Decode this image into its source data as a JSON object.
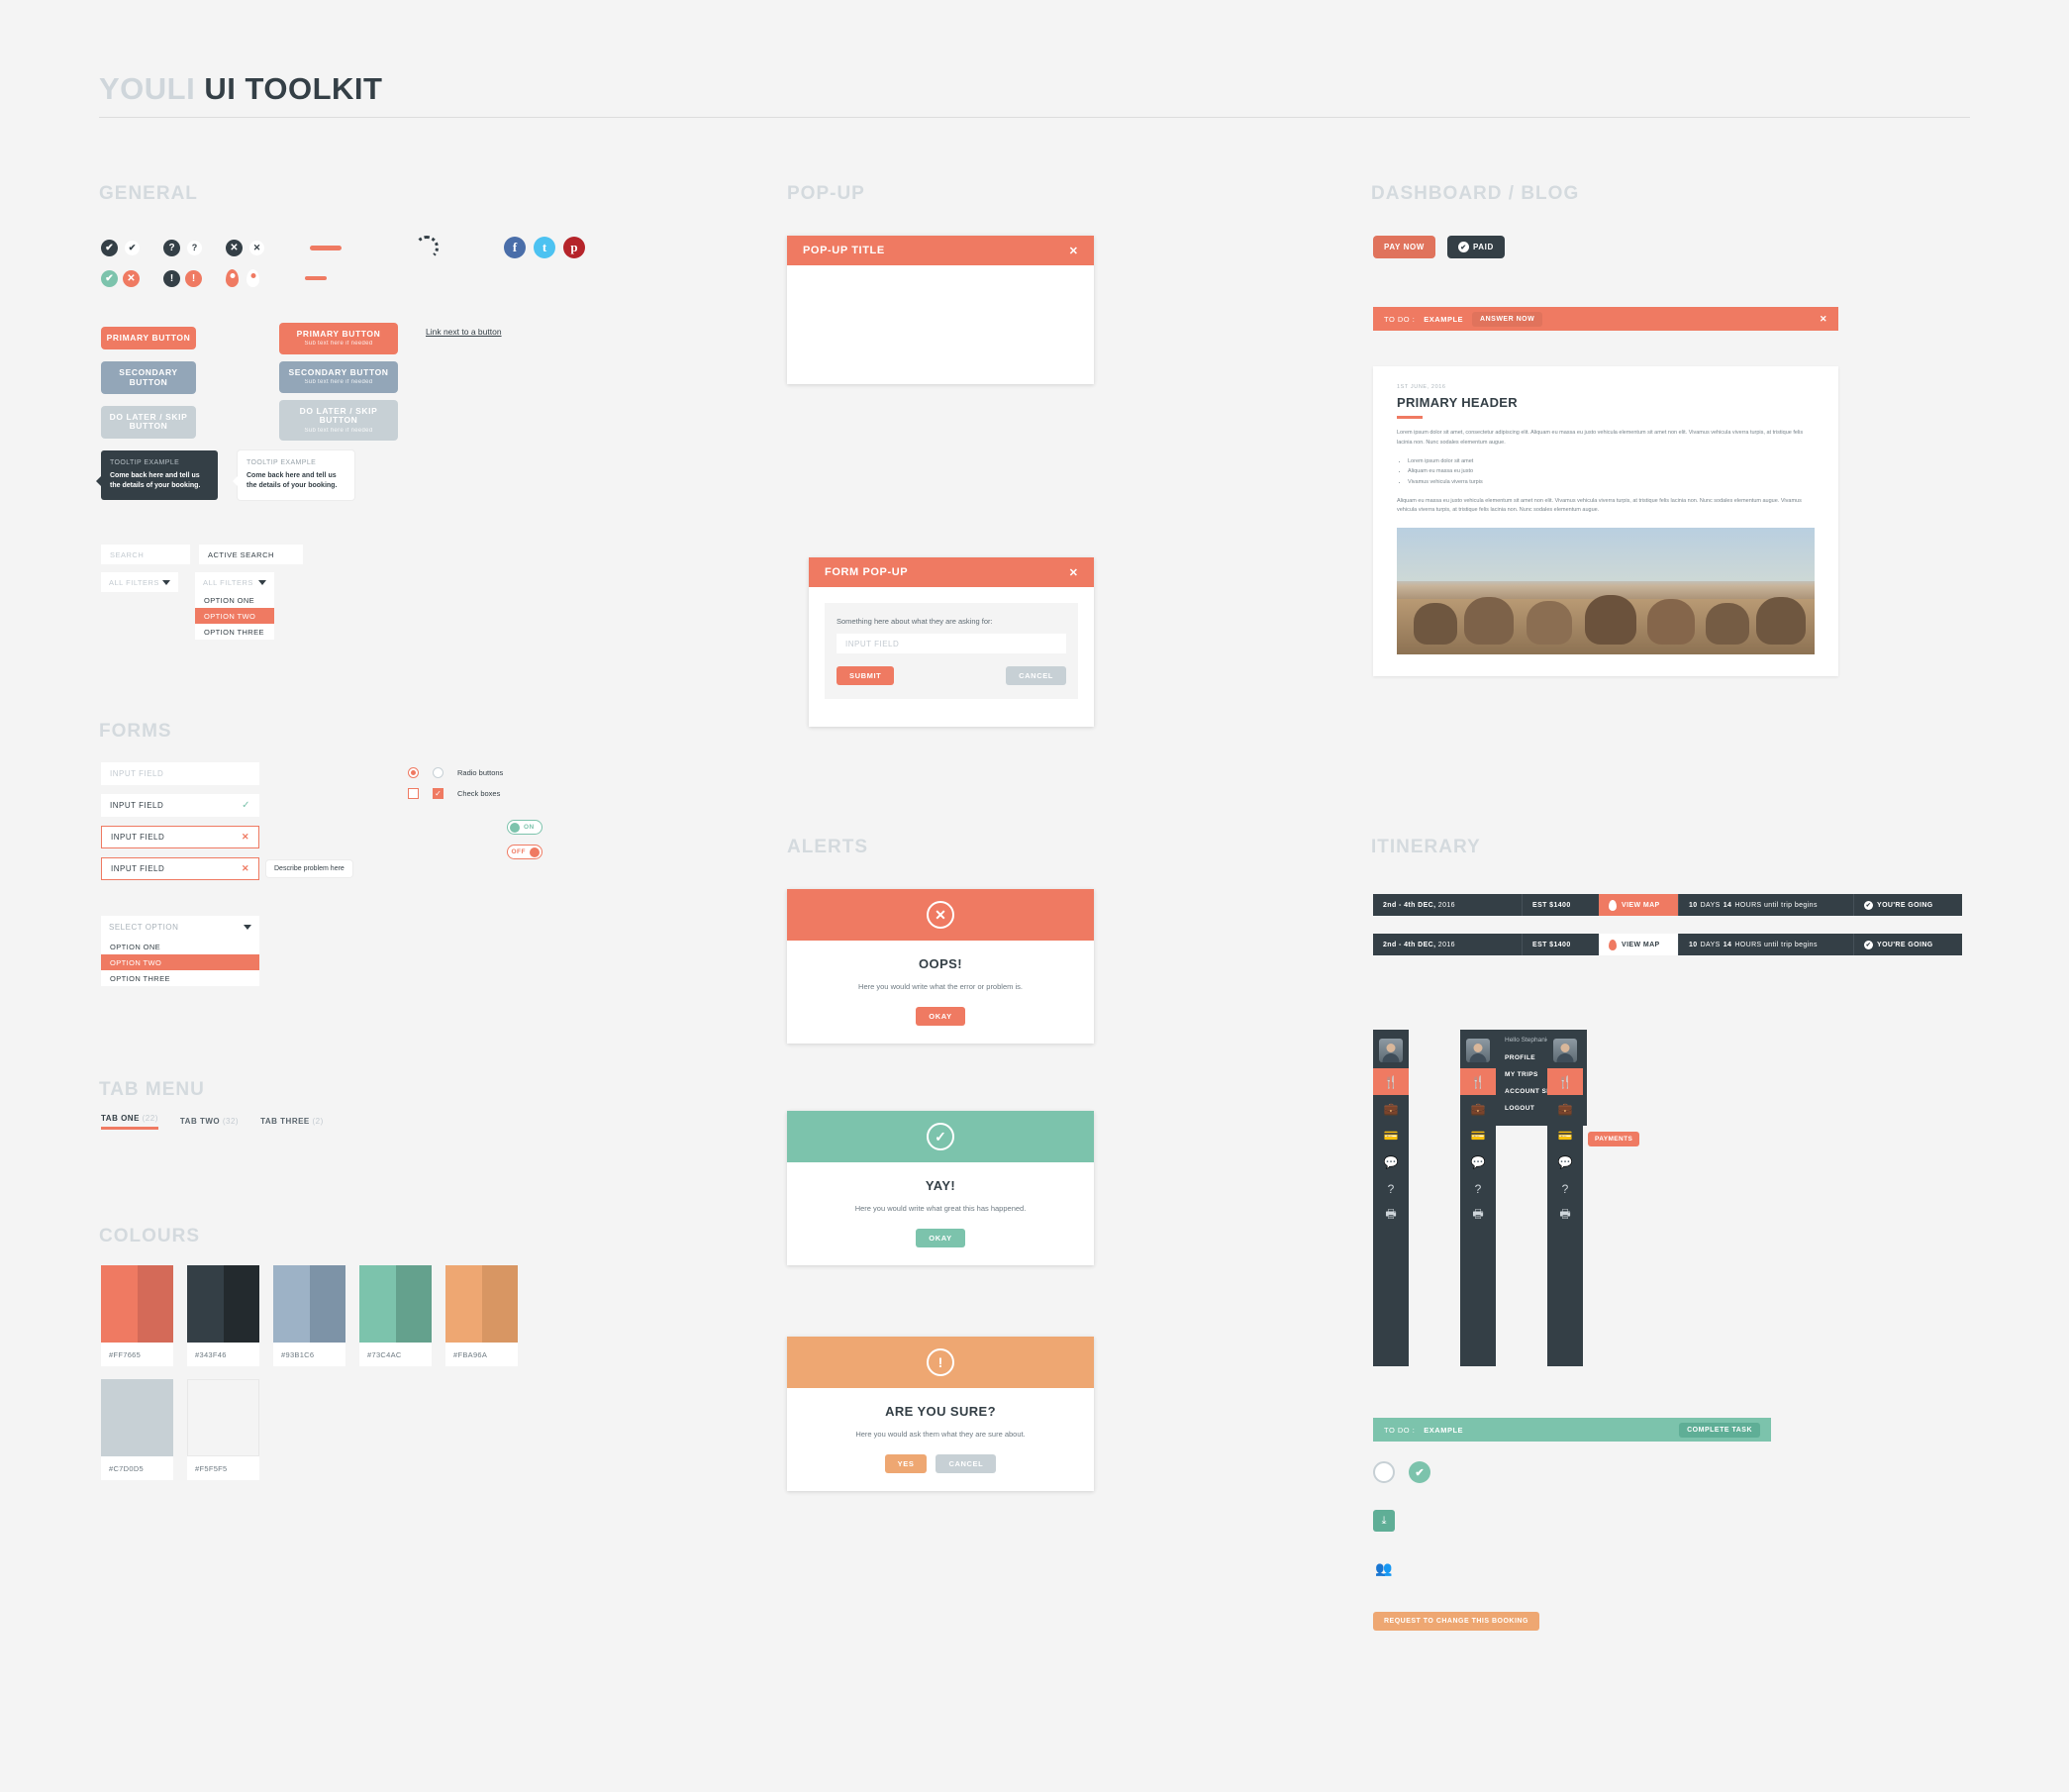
{
  "header": {
    "title_light": "YOULI",
    "title_dark": "UI TOOLKIT"
  },
  "sections": {
    "general": "GENERAL",
    "forms": "FORMS",
    "tab_menu": "TAB MENU",
    "colours": "COLOURS",
    "popup": "POP-UP",
    "alerts": "ALERTS",
    "dashboard": "DASHBOARD / BLOG",
    "itinerary": "ITINERARY"
  },
  "general": {
    "buttons": {
      "primary": "PRIMARY BUTTON",
      "secondary": "SECONDARY BUTTON",
      "skip": "DO LATER / SKIP BUTTON",
      "sub_text": "Sub text here if needed",
      "link_note": "Link next to a button"
    },
    "tooltip": {
      "title": "TOOLTIP EXAMPLE",
      "body": "Come back here and tell us the details of your booking."
    },
    "search": {
      "placeholder": "SEARCH",
      "active_value": "ACTIVE SEARCH",
      "filter_label": "ALL FILTERS",
      "options": [
        "OPTION ONE",
        "OPTION TWO",
        "OPTION THREE"
      ],
      "selected_option": "OPTION TWO"
    }
  },
  "forms": {
    "input_placeholder": "INPUT FIELD",
    "fields": [
      {
        "value": "INPUT FIELD",
        "state": "placeholder"
      },
      {
        "value": "INPUT FIELD",
        "state": "valid"
      },
      {
        "value": "INPUT FIELD",
        "state": "error"
      },
      {
        "value": "INPUT FIELD",
        "state": "error-note"
      }
    ],
    "problem_note": "Describe problem here",
    "radio_label": "Radio buttons",
    "check_label": "Check boxes",
    "toggle_on": "ON",
    "toggle_off": "OFF",
    "select_placeholder": "SELECT OPTION",
    "select_options": [
      "OPTION ONE",
      "OPTION TWO",
      "OPTION THREE"
    ],
    "select_selected": "OPTION TWO"
  },
  "tabs": [
    {
      "label": "TAB ONE",
      "count": "(22)",
      "active": true
    },
    {
      "label": "TAB TWO",
      "count": "(32)",
      "active": false
    },
    {
      "label": "TAB THREE",
      "count": "(2)",
      "active": false
    }
  ],
  "colours": [
    {
      "hex": "#FF7665",
      "swatch": "#ef7a62",
      "dark": "#d46a58"
    },
    {
      "hex": "#343F46",
      "swatch": "#343f46",
      "dark": "#232a2e"
    },
    {
      "hex": "#93B1C6",
      "swatch": "#9db2c6",
      "dark": "#7d93a7"
    },
    {
      "hex": "#73C4AC",
      "swatch": "#7cc3ac",
      "dark": "#64a18d"
    },
    {
      "hex": "#FBA96A",
      "swatch": "#eea772",
      "dark": "#d89663"
    },
    {
      "hex": "#C7D0D5",
      "swatch": "#c7d0d5",
      "dark": "#c7d0d5"
    },
    {
      "hex": "#F5F5F5",
      "swatch": "#f4f4f4",
      "dark": "#f4f4f4"
    }
  ],
  "popups": {
    "plain": {
      "title": "POP-UP TITLE",
      "close": "✕"
    },
    "form": {
      "title": "FORM POP-UP",
      "close": "✕",
      "label": "Something here about what they are asking for:",
      "input_placeholder": "INPUT FIELD",
      "submit": "SUBMIT",
      "cancel": "CANCEL"
    }
  },
  "alerts": [
    {
      "icon": "✕",
      "color": "#ef7a62",
      "title": "OOPS!",
      "text": "Here you would write what the error or problem is.",
      "buttons": [
        {
          "label": "OKAY",
          "style": "red"
        }
      ]
    },
    {
      "icon": "✓",
      "color": "#7cc3ac",
      "title": "YAY!",
      "text": "Here you would write what great this has happened.",
      "buttons": [
        {
          "label": "OKAY",
          "style": "green"
        }
      ]
    },
    {
      "icon": "!",
      "color": "#eea772",
      "title": "ARE YOU SURE?",
      "text": "Here you would ask them what they are sure about.",
      "buttons": [
        {
          "label": "YES",
          "style": "orange"
        },
        {
          "label": "CANCEL",
          "style": "grey"
        }
      ]
    }
  ],
  "dashboard": {
    "pay_now": "PAY NOW",
    "paid": "PAID",
    "todo_prefix": "TO DO :",
    "todo_label": "EXAMPLE",
    "answer_now": "ANSWER NOW",
    "close": "✕",
    "card": {
      "date": "1ST JUNE, 2016",
      "heading": "PRIMARY HEADER",
      "paragraph1": "Lorem ipsum dolor sit amet, consectetur adipiscing elit. Aliquam eu massa eu justo vehicula elementum sit amet non elit. Vivamus vehicula viverra turpis, at tristique felis lacinia non. Nunc sodales elementum augue.",
      "list": [
        "Lorem ipsum dolor sit amet",
        "Aliquam eu massa eu justo",
        "Vivamus vehicula viverra turpis"
      ],
      "paragraph2": "Aliquam eu massa eu justo vehicula elementum sit amet non elit. Vivamus vehicula viverra turpis, at tristique felis lacinia non. Nunc sodales elementum augue. Vivamus vehicula viverra turpis, at tristique felis lacinia non. Nunc sodales elementum augue."
    }
  },
  "itinerary": {
    "rows": [
      {
        "dates": "2nd - 4th DEC,",
        "year": "2016",
        "est": "EST $1400",
        "map": "VIEW MAP",
        "countdown_days": "10",
        "countdown_days_label": "DAYS",
        "countdown_hours": "14",
        "countdown_text": "HOURS until trip begins",
        "status": "YOU'RE GOING"
      },
      {
        "dates": "2nd - 4th DEC,",
        "year": "2016",
        "est": "EST $1400",
        "map": "VIEW MAP",
        "countdown_days": "10",
        "countdown_days_label": "DAYS",
        "countdown_hours": "14",
        "countdown_text": "HOURS until trip begins",
        "status": "YOU'RE GOING"
      }
    ],
    "menu": {
      "greeting": "Hello Stephanie,",
      "items": [
        "PROFILE",
        "MY TRIPS",
        "ACCOUNT SETTINGS",
        "LOGOUT"
      ]
    },
    "payments_badge": "PAYMENTS",
    "todo_prefix": "TO DO :",
    "todo_label": "EXAMPLE",
    "complete_task": "COMPLETE TASK",
    "request_button": "REQUEST TO CHANGE THIS BOOKING"
  }
}
